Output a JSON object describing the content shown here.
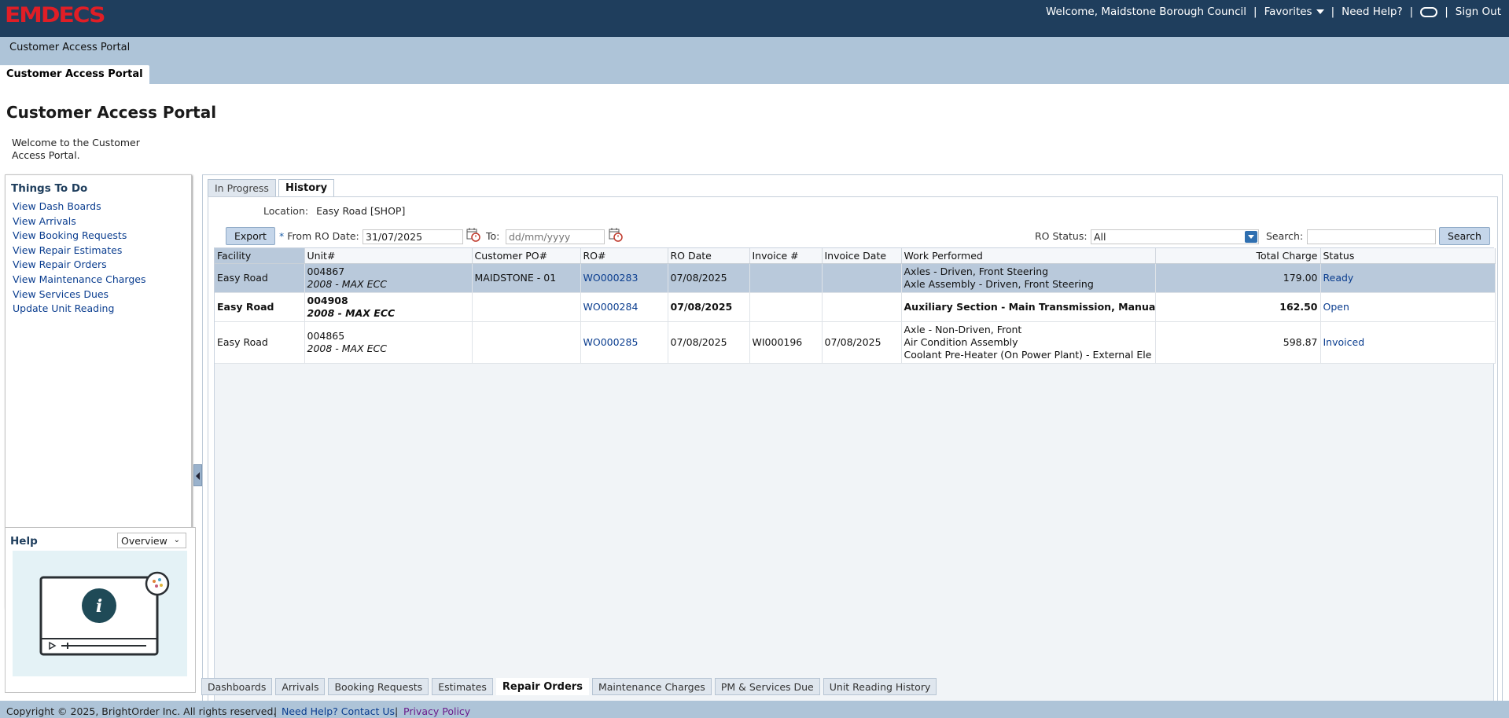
{
  "header": {
    "logo": "EMDECS",
    "welcome": "Welcome, Maidstone Borough Council",
    "favorites": "Favorites",
    "help": "Need Help?",
    "signout": "Sign Out"
  },
  "subtitle": "Customer Access Portal",
  "app_tab": "Customer Access Portal",
  "sidebar": {
    "title": "Customer Access Portal",
    "welcome": "Welcome to the Customer Access Portal.",
    "todo_title": "Things To Do",
    "items": [
      {
        "label": "View Dash Boards"
      },
      {
        "label": "View Arrivals"
      },
      {
        "label": "View Booking Requests"
      },
      {
        "label": "View Repair Estimates"
      },
      {
        "label": "View Repair Orders"
      },
      {
        "label": "View Maintenance Charges"
      },
      {
        "label": "View Services Dues"
      },
      {
        "label": "Update Unit Reading"
      }
    ],
    "help_title": "Help",
    "help_select": "Overview"
  },
  "tabs": {
    "in_progress": "In Progress",
    "history": "History"
  },
  "location": {
    "label": "Location:",
    "value": "Easy Road [SHOP]"
  },
  "filters": {
    "export": "Export",
    "from_label": "From RO Date:",
    "from_value": "31/07/2025",
    "to_label": "To:",
    "to_placeholder": "dd/mm/yyyy",
    "status_label": "RO Status:",
    "status_value": "All",
    "search_label": "Search:",
    "search_button": "Search"
  },
  "table": {
    "headers": [
      "Facility",
      "Unit#",
      "Customer PO#",
      "RO#",
      "RO Date",
      "Invoice #",
      "Invoice Date",
      "Work Performed",
      "Total Charge",
      "Status"
    ],
    "rows": [
      {
        "facility": "Easy Road",
        "unit": "004867",
        "unit_desc": "2008 - MAX ECC",
        "po": "MAIDSTONE - 01",
        "ro": "WO000283",
        "ro_date": "07/08/2025",
        "invoice": "",
        "invoice_date": "",
        "work": [
          "Axles - Driven, Front Steering",
          "Axle Assembly - Driven, Front Steering"
        ],
        "total": "179.00",
        "status": "Ready"
      },
      {
        "facility": "Easy Road",
        "unit": "004908",
        "unit_desc": "2008 - MAX ECC",
        "po": "",
        "ro": "WO000284",
        "ro_date": "07/08/2025",
        "invoice": "",
        "invoice_date": "",
        "work": [
          "Auxiliary Section - Main Transmission, Manual"
        ],
        "total": "162.50",
        "status": "Open"
      },
      {
        "facility": "Easy Road",
        "unit": "004865",
        "unit_desc": "2008 - MAX ECC",
        "po": "",
        "ro": "WO000285",
        "ro_date": "07/08/2025",
        "invoice": "WI000196",
        "invoice_date": "07/08/2025",
        "work": [
          "Axle - Non-Driven, Front",
          "Air Condition Assembly",
          "Coolant Pre-Heater (On Power Plant) - External Ele"
        ],
        "total": "598.87",
        "status": "Invoiced"
      }
    ]
  },
  "bottom_tabs": [
    {
      "label": "Dashboards"
    },
    {
      "label": "Arrivals"
    },
    {
      "label": "Booking Requests"
    },
    {
      "label": "Estimates"
    },
    {
      "label": "Repair Orders"
    },
    {
      "label": "Maintenance Charges"
    },
    {
      "label": "PM & Services Due"
    },
    {
      "label": "Unit Reading History"
    }
  ],
  "footer": {
    "copyright": "Copyright © 2025, BrightOrder Inc. All rights reserved.",
    "contact": "Need Help? Contact Us.",
    "privacy": "Privacy Policy"
  }
}
